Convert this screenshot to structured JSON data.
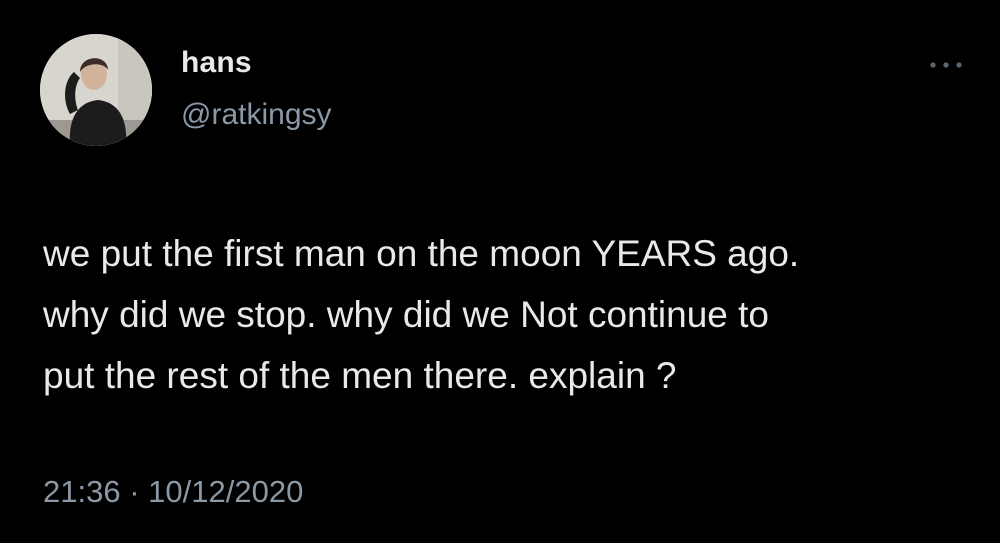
{
  "author": {
    "display_name": "hans",
    "handle": "@ratkingsy",
    "avatar": "profile-photo"
  },
  "menu": {
    "more_icon": "more-horizontal-icon"
  },
  "tweet": {
    "text": "we put the first man on the moon YEARS ago.\nwhy did we stop. why did we Not continue to\nput the rest of the men there. explain ?",
    "time": "21:36",
    "separator": "·",
    "date": "10/12/2020"
  },
  "colors": {
    "background": "#000000",
    "primary_text": "#e7e9ea",
    "secondary_text": "#8b98a5"
  }
}
